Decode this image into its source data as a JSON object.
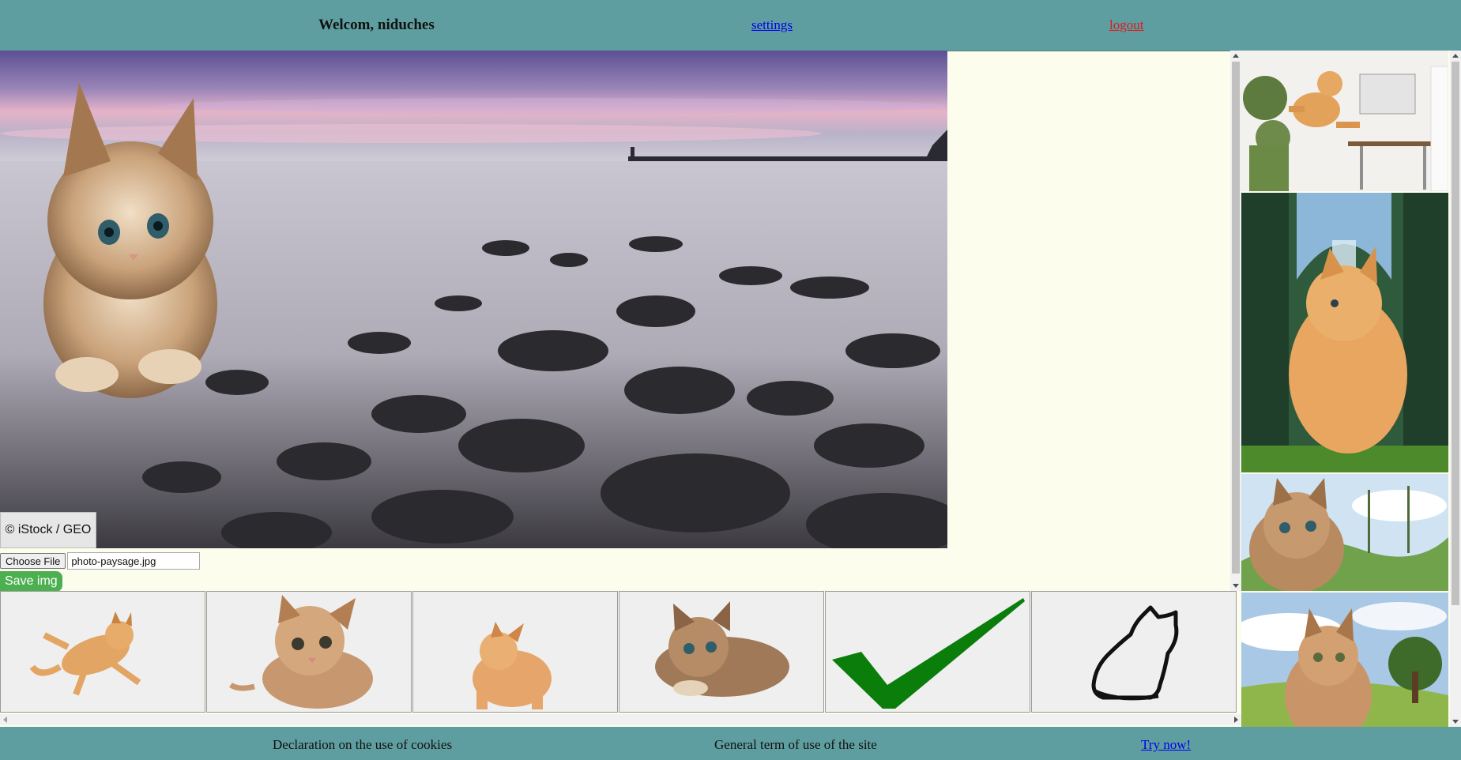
{
  "header": {
    "welcome": "Welcom, niduches",
    "settings": "settings",
    "logout": "logout"
  },
  "editor": {
    "credit": "© iStock / GEO",
    "choose_file": "Choose File",
    "file_name": "photo-paysage.jpg",
    "save": "Save img"
  },
  "sidebar": {
    "images": [
      {
        "name": "cat-jumping-office"
      },
      {
        "name": "kitten-forest-waterfall"
      },
      {
        "name": "kitten-palm-valley"
      },
      {
        "name": "kitten-meadow-tree"
      }
    ]
  },
  "gallery": {
    "stickers": [
      {
        "name": "leaping-cat-sticker"
      },
      {
        "name": "tabby-kitten-sticker"
      },
      {
        "name": "orange-kitten-sticker"
      },
      {
        "name": "fluffy-kitten-sticker"
      },
      {
        "name": "checkmark-sticker"
      },
      {
        "name": "cat-outline-sticker"
      }
    ]
  },
  "footer": {
    "cookies": "Declaration on the use of cookies",
    "terms": "General term of use of the site",
    "try": "Try now!"
  },
  "colors": {
    "bar": "#5f9ea0",
    "page_bg": "#fdfdee",
    "save_button": "#4caf50",
    "link": "#0000ee",
    "logout_link": "#e0191b"
  }
}
